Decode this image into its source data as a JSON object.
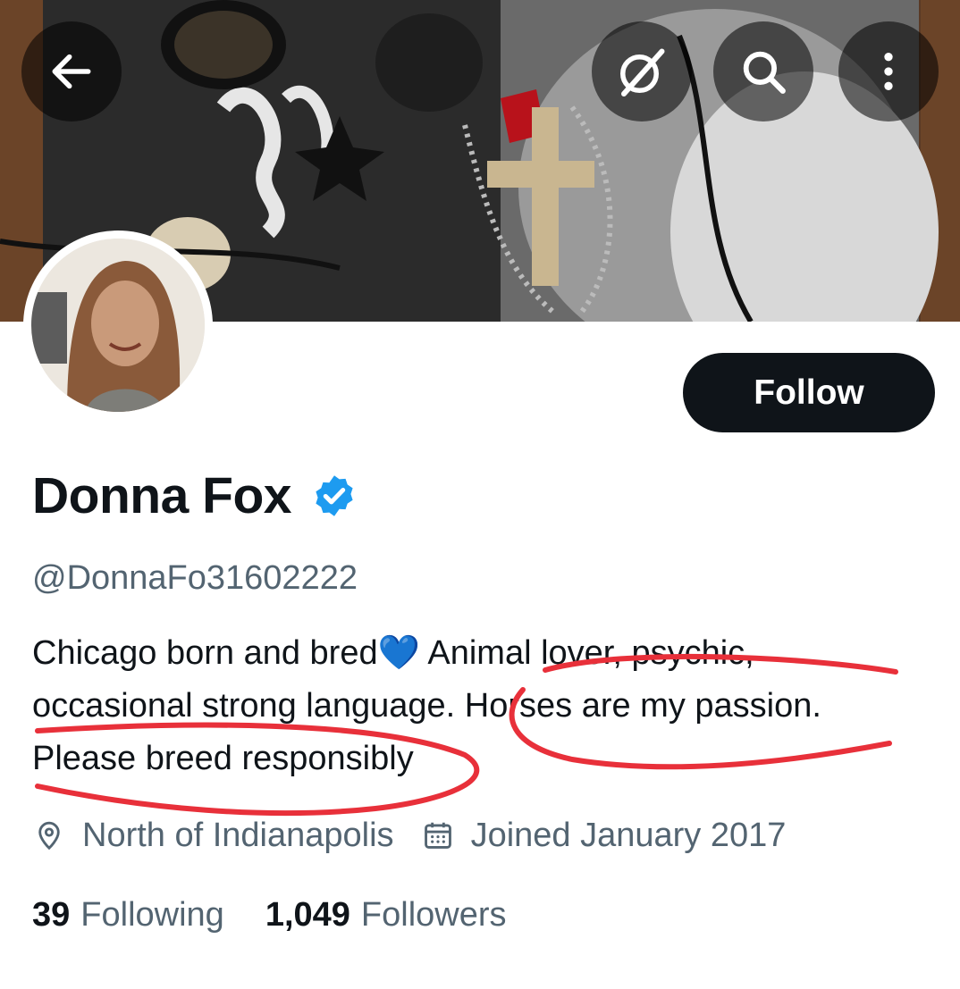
{
  "header": {
    "back_icon": "arrow-left-icon",
    "grok_icon": "grok-icon",
    "search_icon": "search-icon",
    "more_icon": "more-vertical-icon"
  },
  "profile": {
    "display_name": "Donna Fox",
    "verified": true,
    "handle": "@DonnaFo31602222",
    "follow_label": "Follow",
    "bio_lines": [
      "Chicago born and bred💙 Animal lover, psychic,",
      "occasional strong language. Horses are my passion.",
      "Please breed responsibly"
    ],
    "location": "North of Indianapolis",
    "joined": "Joined January 2017",
    "stats": {
      "following_count": "39",
      "following_label": "Following",
      "followers_count": "1,049",
      "followers_label": "Followers"
    }
  },
  "colors": {
    "primary_text": "#0f1419",
    "secondary_text": "#536471",
    "verified_blue": "#1d9bf0",
    "annotation_red": "#e8303a"
  }
}
